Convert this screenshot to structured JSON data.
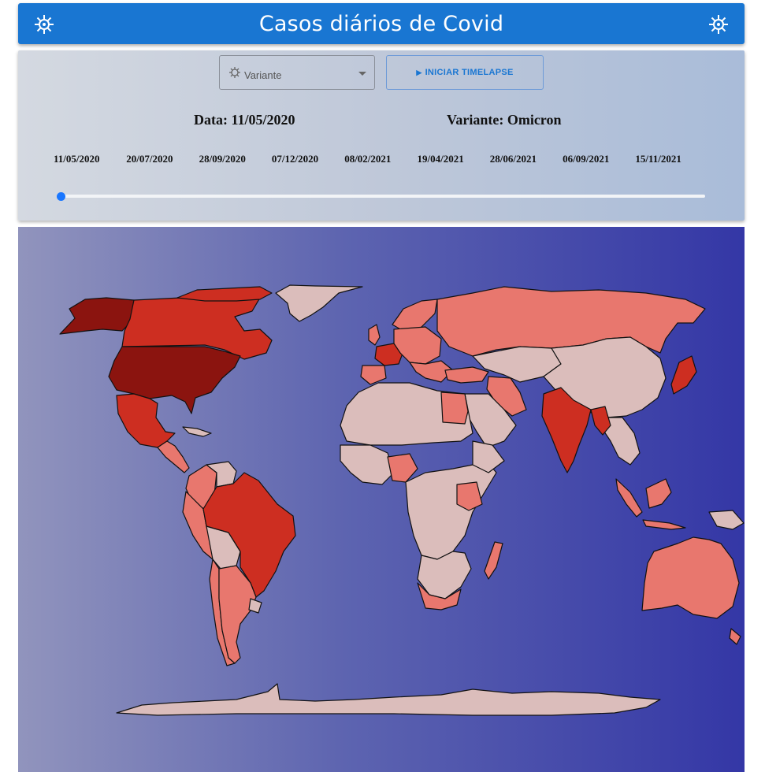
{
  "header": {
    "title": "Casos diários de Covid"
  },
  "controls": {
    "variant_placeholder": "Variante",
    "timelapse_label": "INICIAR TIMELAPSE",
    "date_text": "Data: 11/05/2020",
    "variant_text": "Variante: Omicron"
  },
  "timeline": {
    "ticks": [
      "11/05/2020",
      "20/07/2020",
      "28/09/2020",
      "07/12/2020",
      "08/02/2021",
      "19/04/2021",
      "28/06/2021",
      "06/09/2021",
      "15/11/2021"
    ],
    "selected_index": 0,
    "position_fraction": 0
  },
  "colors": {
    "appbar": "#1976d2",
    "very_high": "#8b140f",
    "high": "#cd2e21",
    "medium": "#e8776e",
    "low": "#dbbdbb",
    "slider_thumb": "#1976ff"
  },
  "icons": {
    "appbar_left": "virus-icon",
    "appbar_right": "virus-icon",
    "select": "virus-icon",
    "button": "play-icon"
  }
}
